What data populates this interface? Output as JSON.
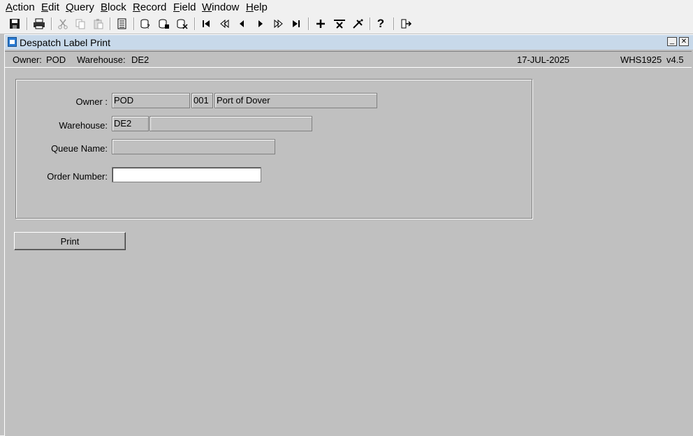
{
  "menu": [
    {
      "label": "Action",
      "accel": "A"
    },
    {
      "label": "Edit",
      "accel": "E"
    },
    {
      "label": "Query",
      "accel": "Q"
    },
    {
      "label": "Block",
      "accel": "B"
    },
    {
      "label": "Record",
      "accel": "R"
    },
    {
      "label": "Field",
      "accel": "F"
    },
    {
      "label": "Window",
      "accel": "W"
    },
    {
      "label": "Help",
      "accel": "H"
    }
  ],
  "toolbar": {
    "icons": [
      "save-icon",
      "print-icon",
      "cut-icon",
      "copy-icon",
      "paste-icon",
      "list-icon",
      "enter-query-icon",
      "execute-query-icon",
      "cancel-query-icon",
      "first-record-icon",
      "previous-set-icon",
      "previous-record-icon",
      "next-record-icon",
      "next-set-icon",
      "last-record-icon",
      "insert-record-icon",
      "remove-record-icon",
      "clear-record-icon",
      "help-icon",
      "exit-icon"
    ],
    "help_glyph": "?"
  },
  "window": {
    "title": "Despatch Label Print",
    "minimize_glyph": "_",
    "close_glyph": "✕"
  },
  "infobar": {
    "owner_label": "Owner:",
    "owner_value": "POD",
    "warehouse_label": "Warehouse:",
    "warehouse_value": "DE2",
    "date": "17-JUL-2025",
    "module": "WHS1925",
    "version": "v4.5"
  },
  "form": {
    "owner_label": "Owner :",
    "owner_code": "POD",
    "owner_num": "001",
    "owner_name": "Port of Dover",
    "warehouse_label": "Warehouse:",
    "warehouse_code": "DE2",
    "warehouse_name": "",
    "queue_label": "Queue Name:",
    "queue_value": "",
    "order_label": "Order Number:",
    "order_value": ""
  },
  "actions": {
    "print_label": "Print"
  }
}
